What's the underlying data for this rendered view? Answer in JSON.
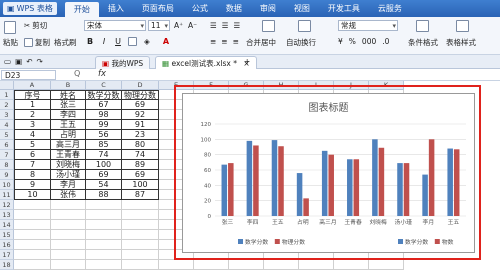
{
  "app": {
    "button_label": "WPS 表格"
  },
  "menu": [
    "开始",
    "插入",
    "页面布局",
    "公式",
    "数据",
    "审阅",
    "视图",
    "开发工具",
    "云服务"
  ],
  "toolbar": {
    "cut": "剪切",
    "paste": "粘贴",
    "copy": "复制",
    "format_painter": "格式刷",
    "font_name": "宋体",
    "font_size": "11",
    "bold": "B",
    "italic": "I",
    "underline": "U",
    "font_color": "A",
    "merge_center": "合并居中",
    "wrap_text": "自动换行",
    "number_format": "常规",
    "percent": "%",
    "thousands": "000",
    "conditional_format": "条件格式",
    "table_style": "表格样式"
  },
  "tabs": [
    {
      "label": "我的WPS"
    },
    {
      "label": "excel测试表.xlsx *"
    }
  ],
  "formula": {
    "cell_ref": "D23",
    "fx": "fx",
    "q": "Q"
  },
  "columns": [
    "A",
    "B",
    "C",
    "D",
    "E",
    "F",
    "G",
    "H",
    "I",
    "J",
    "K"
  ],
  "rows": [
    "1",
    "2",
    "3",
    "4",
    "5",
    "6",
    "7",
    "8",
    "9",
    "10",
    "11",
    "12",
    "13",
    "14",
    "15",
    "16",
    "17",
    "18"
  ],
  "table": {
    "headers": [
      "序号",
      "姓名",
      "数学分数",
      "物理分数"
    ],
    "rows": [
      [
        "1",
        "张三",
        "67",
        "69"
      ],
      [
        "2",
        "李四",
        "98",
        "92"
      ],
      [
        "3",
        "王五",
        "99",
        "91"
      ],
      [
        "4",
        "占明",
        "56",
        "23"
      ],
      [
        "5",
        "高三月",
        "85",
        "80"
      ],
      [
        "6",
        "王青春",
        "74",
        "74"
      ],
      [
        "7",
        "刘晓梅",
        "100",
        "89"
      ],
      [
        "8",
        "汤小瑾",
        "69",
        "69"
      ],
      [
        "9",
        "李月",
        "54",
        "100"
      ],
      [
        "10",
        "张伟",
        "88",
        "87"
      ]
    ]
  },
  "chart_data": {
    "type": "bar",
    "title": "图表标题",
    "categories": [
      "张三",
      "李四",
      "王五",
      "占明",
      "高三月",
      "王青春",
      "刘晓梅",
      "汤小瑾",
      "李月",
      "王五"
    ],
    "series": [
      {
        "name": "数学分数",
        "values": [
          67,
          98,
          99,
          56,
          85,
          74,
          100,
          69,
          54,
          88
        ],
        "color": "#4f81bd"
      },
      {
        "name": "物理分数",
        "values": [
          69,
          92,
          91,
          23,
          80,
          74,
          89,
          69,
          100,
          87
        ],
        "color": "#c0504d"
      }
    ],
    "ylim": [
      0,
      120
    ],
    "yticks": [
      "0",
      "20",
      "40",
      "60",
      "80",
      "100",
      "120"
    ],
    "grid": true,
    "legend_left": [
      "数学分数",
      "物理分数"
    ],
    "legend_right": [
      "数学分数",
      "物数"
    ],
    "highlight_color": "#e0221c"
  }
}
